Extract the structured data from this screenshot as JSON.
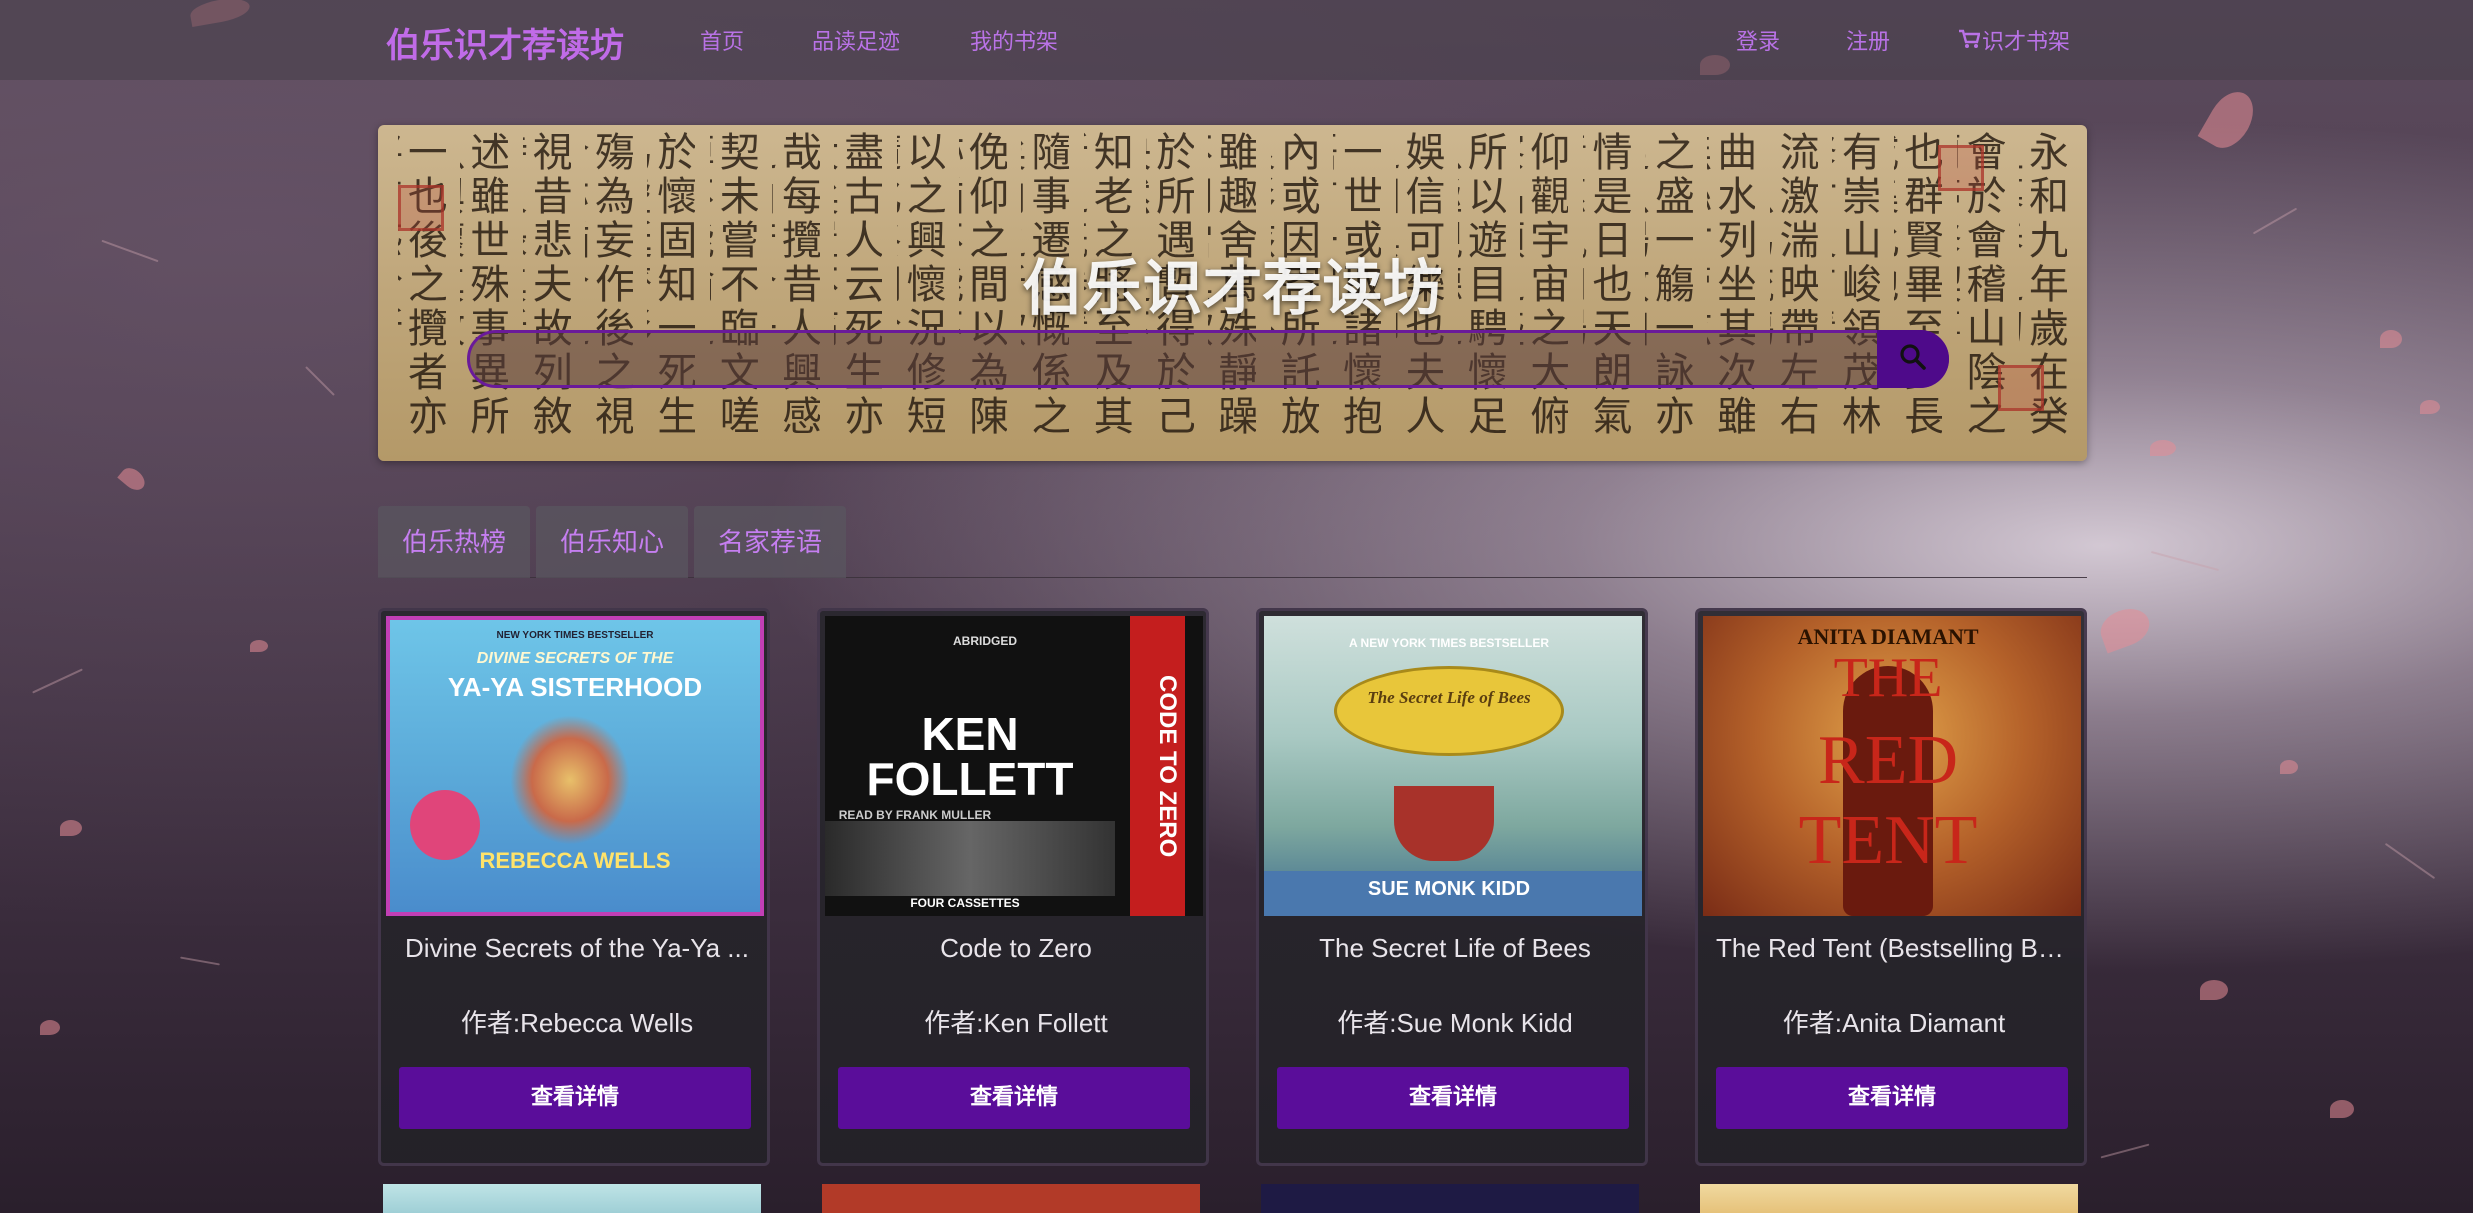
{
  "navbar": {
    "brand": "伯乐识才荐读坊",
    "links": [
      "首页",
      "品读足迹",
      "我的书架"
    ],
    "login": "登录",
    "register": "注册",
    "cart": "识才书架",
    "accent": "#b972e6"
  },
  "banner": {
    "title": "伯乐识才荐读坊",
    "search": {
      "value": "",
      "placeholder": ""
    },
    "calligraphy": [
      "永和九年歲在癸丑暮春之初",
      "會於會稽山陰之蘭亭修禊事",
      "也群賢畢至少長咸集此地",
      "有崇山峻領茂林修竹又有清",
      "流激湍映帶左右引以為流觴",
      "曲水列坐其次雖無絲竹管弦",
      "之盛一觴一詠亦足以暢敘幽",
      "情是日也天朗氣清惠風和暢",
      "仰觀宇宙之大俯察品類之盛",
      "所以遊目騁懷足以極視聽之",
      "娛信可樂也夫人之相與俯仰",
      "一世或取諸懷抱悟言一室之",
      "內或因寄所託放浪形骸之外",
      "雖趣舍萬殊靜躁不同當其欣",
      "於所遇暫得於己快然自足不",
      "知老之將至及其所之既倦情",
      "隨事遷感慨係之矣向之所欣",
      "俛仰之間以為陳跡猶不能不",
      "以之興懷況修短隨化終期於",
      "盡古人云死生亦大矣豈不痛",
      "哉每攬昔人興感之由若合一",
      "契未嘗不臨文嗟悼不能喻之",
      "於懷固知一死生為虛誕齊彭",
      "殤為妄作後之視今亦猶今之",
      "視昔悲夫故列敘時人錄其所",
      "述雖世殊事異所以興懷其致",
      "一也後之攬者亦將有感於斯"
    ]
  },
  "tabs": [
    "伯乐热榜",
    "伯乐知心",
    "名家荐语"
  ],
  "books": [
    {
      "title": "Divine Secrets of the Ya-Ya ...",
      "author": "作者:Rebecca Wells",
      "button": "查看详情",
      "cover": {
        "line1": "DIVINE SECRETS OF THE",
        "line2": "YA-YA SISTERHOOD",
        "author": "REBECCA WELLS",
        "badge": "NEW YORK TIMES BESTSELLER"
      }
    },
    {
      "title": "Code to Zero",
      "author": "作者:Ken Follett",
      "button": "查看详情",
      "cover": {
        "line1": "KEN",
        "line2": "FOLLETT",
        "side": "CODE TO ZERO",
        "tag": "ABRIDGED",
        "reader": "READ BY FRANK MULLER",
        "bottom": "FOUR CASSETTES"
      }
    },
    {
      "title": "The Secret Life of Bees",
      "author": "作者:Sue Monk Kidd",
      "button": "查看详情",
      "cover": {
        "badge": "A NEW YORK TIMES BESTSELLER",
        "line1": "The Secret Life of Bees",
        "author": "SUE MONK KIDD"
      }
    },
    {
      "title": "The Red Tent (Bestselling Ba...",
      "author": "作者:Anita Diamant",
      "button": "查看详情",
      "cover": {
        "author": "ANITA DIAMANT",
        "line1": "THE",
        "line2": "RED",
        "line3": "TENT"
      }
    }
  ]
}
